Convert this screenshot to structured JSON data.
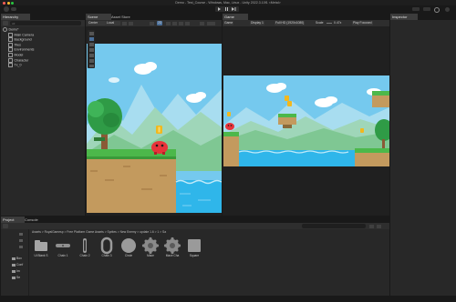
{
  "window": {
    "title": "Demo - Test_Course - Windows, Mac, Linux - Unity 2022.3.10f1 <Metal>",
    "account_label": "A",
    "play_icon": "play-icon",
    "pause_icon": "pause-icon",
    "step_icon": "step-icon"
  },
  "hierarchy": {
    "tab": "Hierarchy",
    "search_placeholder": "All",
    "items": [
      {
        "label": "Demo*",
        "icon": "unity-scene-icon",
        "indent": 0
      },
      {
        "label": "Main Camera",
        "icon": "gameobject-icon",
        "indent": 1
      },
      {
        "label": "Background",
        "icon": "gameobject-icon",
        "indent": 1
      },
      {
        "label": "Tiles",
        "icon": "gameobject-icon",
        "indent": 1
      },
      {
        "label": "Environments",
        "icon": "gameobject-icon",
        "indent": 1
      },
      {
        "label": "Model",
        "icon": "gameobject-icon",
        "indent": 1
      },
      {
        "label": "Character",
        "icon": "gameobject-icon",
        "indent": 1
      },
      {
        "label": "Tx_0",
        "icon": "gameobject-icon",
        "indent": 1
      }
    ]
  },
  "scene": {
    "tabs": [
      "Scene",
      "Asset Store"
    ],
    "active_tab": "Scene",
    "toolbar": {
      "center_label": "Center",
      "local_label": "Local",
      "mode_2d": "2D"
    }
  },
  "game": {
    "tab": "Game",
    "toolbar": {
      "view": "Game",
      "display": "Display 1",
      "resolution": "Full HD (1920x1080)",
      "scale": "Scale",
      "scale_value": "0.47x",
      "play_mode": "Play Focused"
    }
  },
  "inspector": {
    "tab": "Inspector"
  },
  "project": {
    "tabs": [
      "Project",
      "Console"
    ],
    "active_tab": "Project",
    "breadcrumb": "Assets > RoyalGamesp > Free Platform Game Assets > Sprites > New Enemy > update 1.6 > 1 > Sa",
    "folders": [
      "Box",
      "Conf",
      "Im",
      "Se"
    ],
    "assets": [
      {
        "label": "UI Blank S",
        "icon": "folder-icon"
      },
      {
        "label": "Chain 1",
        "icon": "chain-icon"
      },
      {
        "label": "Chain 2",
        "icon": "chain-link-icon"
      },
      {
        "label": "Chain 3",
        "icon": "chain-ring-icon"
      },
      {
        "label": "Circle",
        "icon": "circle-icon"
      },
      {
        "label": "Mace",
        "icon": "gear-icon"
      },
      {
        "label": "Mace Cha",
        "icon": "gear-icon"
      },
      {
        "label": "Square",
        "icon": "square-icon"
      }
    ]
  },
  "colors": {
    "sky": "#74c9f0",
    "grass": "#4cb84a",
    "dirt": "#c39a5e",
    "water": "#2fb6ea",
    "enemy": "#e8333a",
    "coin": "#f2b81e",
    "bush": "#2f9b46"
  }
}
